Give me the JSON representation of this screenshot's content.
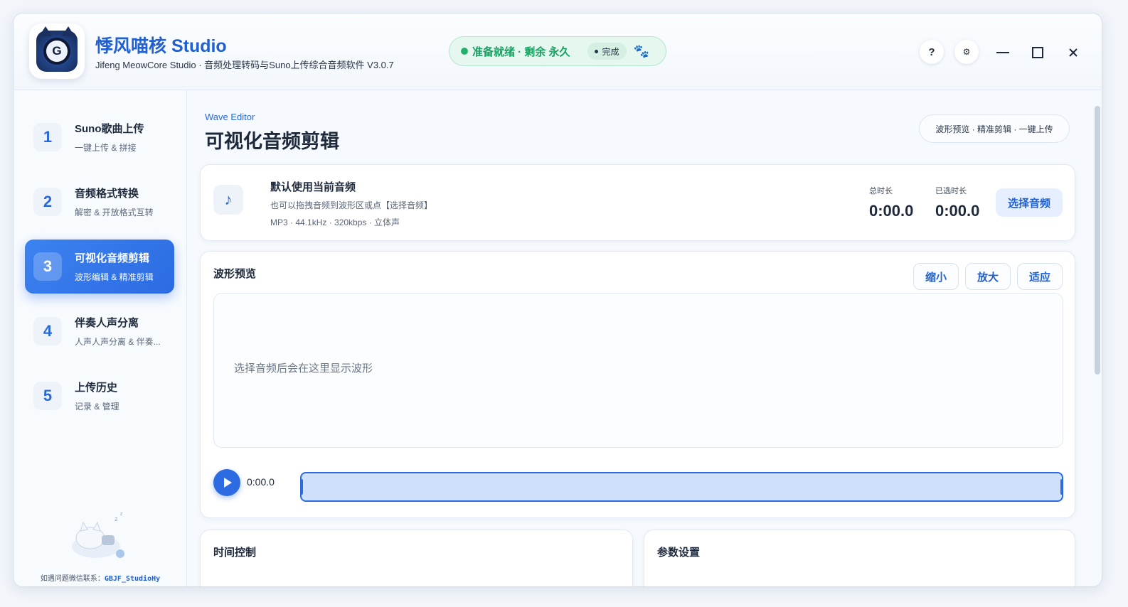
{
  "header": {
    "app_title": "悸风喵核 Studio",
    "app_subtitle": "Jifeng MeowCore Studio · 音频处理转码与Suno上传综合音频软件 V3.0.7",
    "logo_letter": "G",
    "status": {
      "text": "准备就绪 · 剩余 永久",
      "badge": "完成",
      "color": "#19a062"
    },
    "help_label": "?",
    "settings_label": "⚙"
  },
  "sidebar": {
    "items": [
      {
        "num": "1",
        "title": "Suno歌曲上传",
        "sub": "一键上传 & 拼接"
      },
      {
        "num": "2",
        "title": "音频格式转换",
        "sub": "解密 & 开放格式互转"
      },
      {
        "num": "3",
        "title": "可视化音频剪辑",
        "sub": "波形编辑 & 精准剪辑"
      },
      {
        "num": "4",
        "title": "伴奏人声分离",
        "sub": "人声人声分离 & 伴奏..."
      },
      {
        "num": "5",
        "title": "上传历史",
        "sub": "记录 & 管理"
      }
    ],
    "active_index": 2,
    "contact_label": "如遇问题微信联系：",
    "contact_id": "GBJF_StudioHy"
  },
  "main": {
    "eyebrow": "Wave Editor",
    "title": "可视化音频剪辑",
    "tags": "波形预览 · 精准剪辑 · 一键上传",
    "file": {
      "title": "默认使用当前音频",
      "hint": "也可以拖拽音频到波形区或点【选择音频】",
      "meta": "MP3 · 44.1kHz · 320kbps · 立体声",
      "total_label": "总时长",
      "total_value": "0:00.0",
      "selected_label": "已选时长",
      "selected_value": "0:00.0",
      "pick_button": "选择音频"
    },
    "wave": {
      "title": "波形预览",
      "zoom_out": "缩小",
      "zoom_in": "放大",
      "fit": "适应",
      "empty_text": "选择音频后会在这里显示波形",
      "current_time": "0:00.0"
    },
    "time_control_title": "时间控制",
    "params_title": "参数设置"
  },
  "colors": {
    "accent": "#2c6be2",
    "success": "#19a062"
  }
}
